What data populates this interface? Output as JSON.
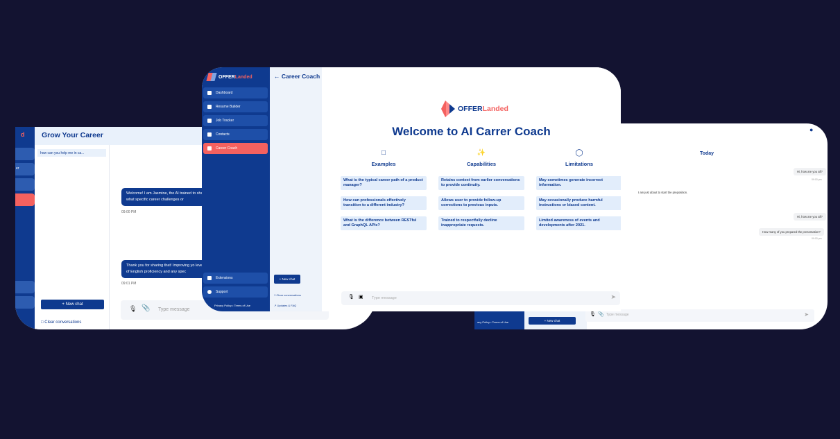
{
  "left": {
    "header_title": "Grow Your Career",
    "history_item": "how can you help me in ca...",
    "msg1": "Welcome! I am Jasmine, the AI trained to share what specific career challenges or",
    "msg1_time": "09:00 PM",
    "msg2": "Thank you for sharing that! Improving yo level of English proficiency and any spec",
    "msg2_time": "09:01 PM",
    "new_chat": "+ New chat",
    "clear": "Clear conversations",
    "placeholder": "Type message",
    "sidebar_fragment_1": "d",
    "sidebar_fragment_2": "er"
  },
  "mid": {
    "logo_main": "OFFER",
    "logo_accent": "Landed",
    "nav": [
      "Dashboard",
      "Resume Builder",
      "Job Tracker",
      "Contacts",
      "Career Coach"
    ],
    "nav_bottom": [
      "Extensions",
      "Support"
    ],
    "footer": [
      "Privacy Policy",
      "Terms of Use"
    ],
    "back_title": "Career Coach",
    "new_chat": "+ New chat",
    "clear": "Clear conversations",
    "updates": "Updates & FAQ",
    "welcome": "Welcome to AI Carrer Coach",
    "columns": [
      {
        "title": "Examples",
        "items": [
          "What is the typical career path of a product manager?",
          "How can professionals effectively transition to a different industry?",
          "What is the difference between RESTful and GraphQL APIs?"
        ]
      },
      {
        "title": "Capabilities",
        "items": [
          "Retains context from earlier conversations to provide continuity.",
          "Allows user to provide follow-up corrections to previous inputs.",
          "Trained to respectfully decline inappropriate requests."
        ]
      },
      {
        "title": "Limitations",
        "items": [
          "May sometimes generate incorrect information.",
          "May occasionally produce harmful instructions or biased content.",
          "Limited awareness of events and developments after 2021."
        ]
      }
    ],
    "placeholder": "Type message"
  },
  "right": {
    "today": "Today",
    "msgs": [
      "Hi, how are you all?",
      "I am just about to start the preposition.",
      "Hi, how are you all?",
      "How many of you prepared the presentation?"
    ],
    "times": [
      "09:03 pm",
      "09:03 pm"
    ],
    "footer": "acy Policy  •  Terms of Use",
    "new_chat": "+ New chat",
    "placeholder": "Type message"
  },
  "colors": {
    "bg": "#131331",
    "brand": "#0f3a8f",
    "accent": "#f4615f"
  }
}
